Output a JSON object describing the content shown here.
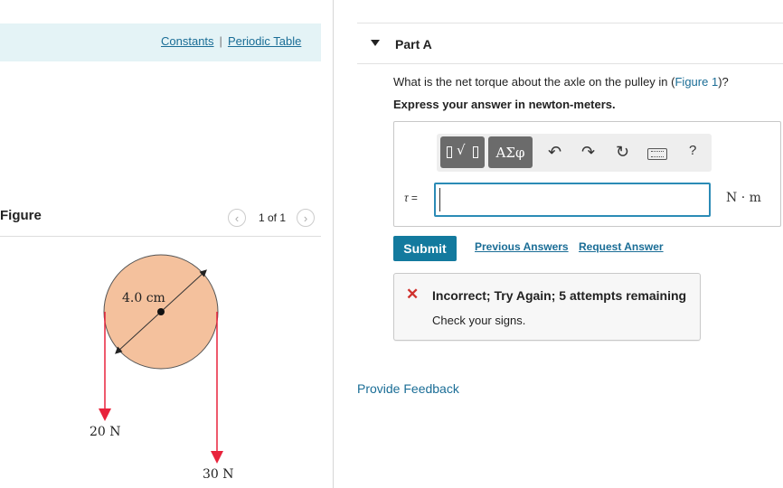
{
  "header": {
    "links": [
      "Constants",
      "Periodic Table"
    ],
    "separator": "|"
  },
  "figure": {
    "title": "Figure",
    "pager": "1 of 1",
    "prev_icon": "chevron-left-icon",
    "next_icon": "chevron-right-icon",
    "diameter_label": "4.0 cm",
    "force_left_label": "20 N",
    "force_right_label": "30 N",
    "colors": {
      "pulley_fill": "#f4c19d",
      "arrow": "#e8233c"
    }
  },
  "part": {
    "title": "Part A",
    "question_prefix": "What is the net torque about the axle on the pulley in (",
    "question_link": "Figure 1",
    "question_suffix": ")?",
    "instruction": "Express your answer in newton-meters."
  },
  "answer": {
    "toolbar": {
      "greek_button": "ΑΣφ",
      "undo_icon": "undo-icon",
      "redo_icon": "redo-icon",
      "reset_icon": "reset-icon",
      "keyboard_icon": "keyboard-icon",
      "help": "?"
    },
    "variable": "τ",
    "equals": "=",
    "value": "",
    "units": "N · m"
  },
  "actions": {
    "submit": "Submit",
    "previous_answers": "Previous Answers",
    "request_answer": "Request Answer"
  },
  "result": {
    "icon": "✕",
    "title": "Incorrect; Try Again; 5 attempts remaining",
    "message": "Check your signs."
  },
  "footer": {
    "provide_feedback": "Provide Feedback"
  }
}
